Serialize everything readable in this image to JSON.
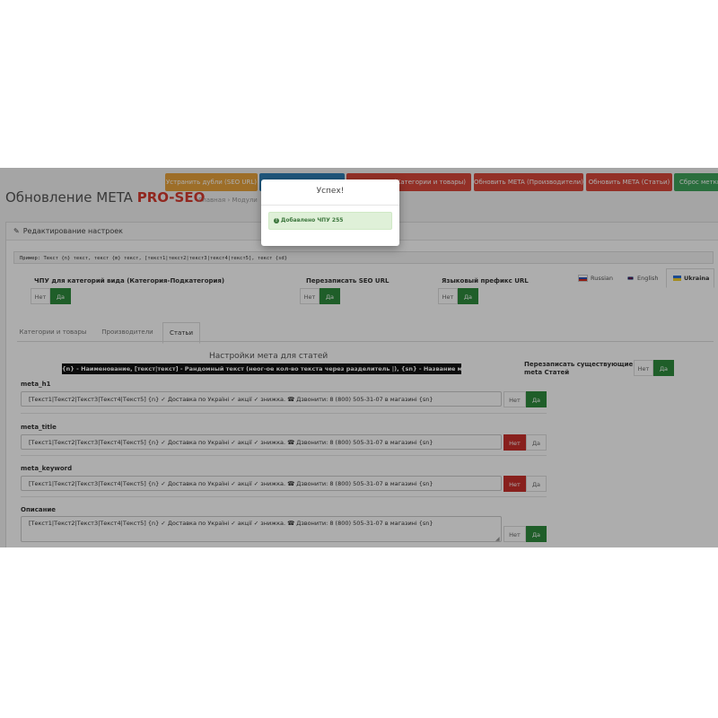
{
  "top_buttons": [
    {
      "label": "Устранить дубли (SEO URL)",
      "color": "#e8a33c"
    },
    {
      "label": "",
      "color": "#2e7fb5"
    },
    {
      "label": "(Категории и товары)",
      "color": "#d9473a"
    },
    {
      "label": "Обновить META (Производители)",
      "color": "#d9473a"
    },
    {
      "label": "Обновить META (Статьи)",
      "color": "#d9473a"
    },
    {
      "label": "Сброс метки",
      "color": "#3fa35a"
    }
  ],
  "header": {
    "title": "Обновление META",
    "brand": "PRO-SEO",
    "breadcrumb_home": "Главная",
    "breadcrumb_sep": "›",
    "breadcrumb_modules": "Модули"
  },
  "panel": {
    "heading": "Редактирование настроек",
    "example": "Пример: Текст {n} текст, текст {m} текст, [текст1|текст2|текст3|текст4|текст5], текст {sd}"
  },
  "settings": {
    "chpu_label": "ЧПУ для категорий вида (Категория-Подкатегория)",
    "rewrite_seo_label": "Перезаписать SEO URL",
    "lang_prefix_label": "Языковый префикс URL",
    "no": "Нет",
    "yes": "Да"
  },
  "languages": [
    {
      "label": "Russian",
      "flag": "ru-flag"
    },
    {
      "label": "English",
      "flag": "gb-flag"
    },
    {
      "label": "Ukraina",
      "flag": "ua-flag"
    }
  ],
  "tabs": [
    {
      "label": "Категории и товары"
    },
    {
      "label": "Производители"
    },
    {
      "label": "Статьи"
    }
  ],
  "article_settings": {
    "heading": "Настройки мета для статей",
    "legend": "{n} - Наименование, [текст|текст] - Рандомный текст (неог-ое кол-во текста через разделитель |), {sn} - Название магазина",
    "rewrite_existing_label_1": "Перезаписать существующие",
    "rewrite_existing_label_2": "meta Статей"
  },
  "fields": [
    {
      "label": "meta_h1",
      "value": "[Текст1|Текст2|Текст3|Текст4|Текст5] {n} ✓ Доставка по Україні ✓ акції ✓ знижка. ☎ Дзвонити: 8 (800) 505-31-07 в магазині {sn}",
      "state": "yes"
    },
    {
      "label": "meta_title",
      "value": "[Текст1|Текст2|Текст3|Текст4|Текст5] {n} ✓ Доставка по Україні ✓ акції ✓ знижка. ☎ Дзвонити: 8 (800) 505-31-07 в магазині {sn}",
      "state": "no"
    },
    {
      "label": "meta_keyword",
      "value": "[Текст1|Текст2|Текст3|Текст4|Текст5] {n} ✓ Доставка по Україні ✓ акції ✓ знижка. ☎ Дзвонити: 8 (800) 505-31-07 в магазині {sn}",
      "state": "no"
    },
    {
      "label": "Описание",
      "value": "[Текст1|Текст2|Текст3|Текст4|Текст5] {n} ✓ Доставка по Україні ✓ акції ✓ знижка. ☎ Дзвонити: 8 (800) 505-31-07 в магазині {sn}",
      "state": "yes"
    }
  ],
  "modal": {
    "title": "Успех!",
    "message": "Добавлено ЧПУ 255",
    "icon": "info-circle-icon"
  },
  "colors": {
    "yes_green": "#2e8b3d",
    "no_red": "#c9302c",
    "brand_red": "#d63a2f",
    "alert_bg": "#dff0d8"
  }
}
